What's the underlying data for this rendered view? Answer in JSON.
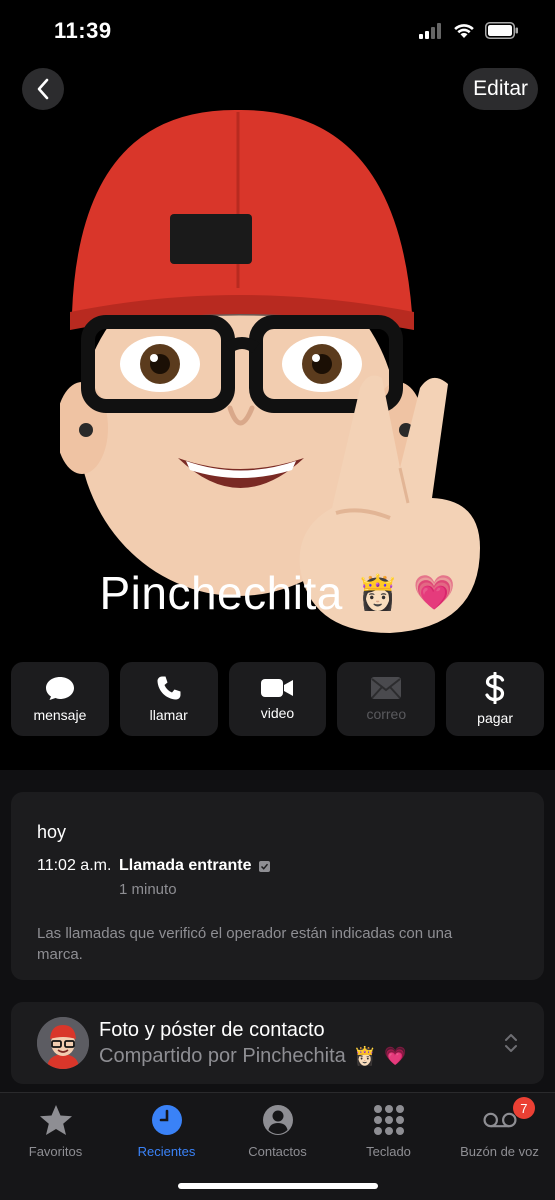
{
  "status_bar": {
    "time": "11:39"
  },
  "nav": {
    "edit_label": "Editar"
  },
  "contact": {
    "name": "Pinchechita",
    "name_emoji_1": "👸🏻",
    "name_emoji_2": "💗"
  },
  "actions": [
    {
      "label": "mensaje",
      "icon": "message-bubble-icon",
      "enabled": true
    },
    {
      "label": "llamar",
      "icon": "phone-icon",
      "enabled": true
    },
    {
      "label": "video",
      "icon": "video-camera-icon",
      "enabled": true
    },
    {
      "label": "correo",
      "icon": "envelope-icon",
      "enabled": false
    },
    {
      "label": "pagar",
      "icon": "dollar-icon",
      "enabled": true
    }
  ],
  "recents": {
    "day": "hoy",
    "time": "11:02 a.m.",
    "call_type": "Llamada entrante",
    "duration": "1 minuto",
    "note": "Las llamadas que verificó el operador están indicadas con una marca."
  },
  "poster": {
    "title": "Foto y póster de contacto",
    "subtitle": "Compartido por Pinchechita",
    "emoji_1": "👸🏻",
    "emoji_2": "💗"
  },
  "tabs": [
    {
      "label": "Favoritos",
      "icon": "star-icon",
      "active": false
    },
    {
      "label": "Recientes",
      "icon": "clock-icon",
      "active": true
    },
    {
      "label": "Contactos",
      "icon": "person-circle-icon",
      "active": false
    },
    {
      "label": "Teclado",
      "icon": "keypad-icon",
      "active": false
    },
    {
      "label": "Buzón de voz",
      "icon": "voicemail-icon",
      "active": false,
      "badge": "7"
    }
  ],
  "colors": {
    "accent": "#3a82f7",
    "badge": "#eb4034",
    "card": "#1c1c1e",
    "secondary_text": "#8e8e93"
  }
}
